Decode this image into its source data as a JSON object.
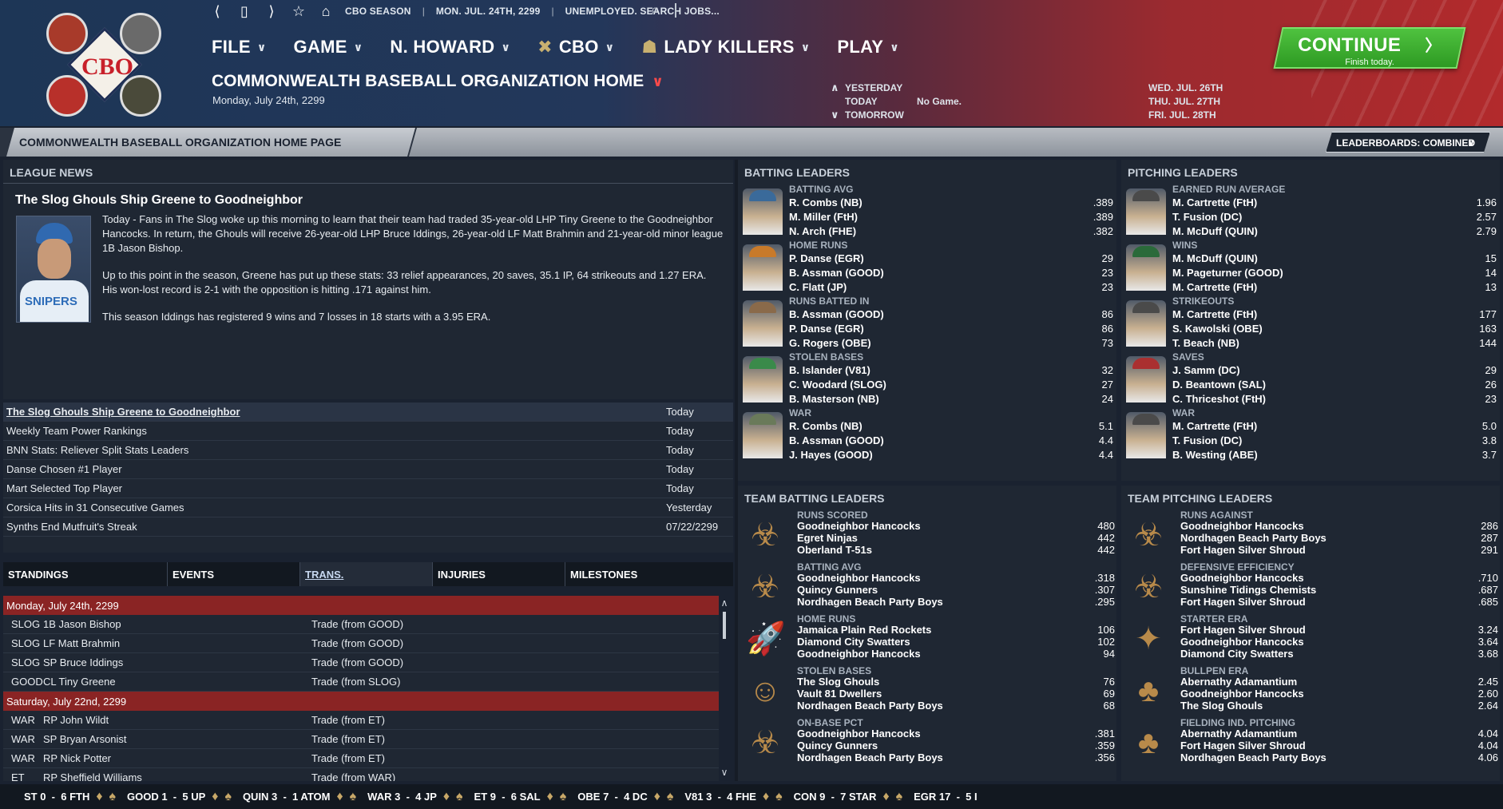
{
  "header": {
    "status": {
      "season": "CBO SEASON",
      "date": "MON. JUL. 24TH, 2299",
      "job": "UNEMPLOYED. SEARCH JOBS..."
    },
    "logo_text": "CBO",
    "menu": [
      {
        "label": "FILE"
      },
      {
        "label": "GAME"
      },
      {
        "label": "N. HOWARD"
      },
      {
        "label": "CBO"
      },
      {
        "label": "LADY KILLERS"
      },
      {
        "label": "PLAY"
      }
    ],
    "page_title": "COMMONWEALTH BASEBALL ORGANIZATION HOME",
    "page_date": "Monday, July 24th, 2299",
    "schedule": [
      {
        "arrow": "∧",
        "label": "YESTERDAY",
        "game": "",
        "next": "WED. JUL. 26TH"
      },
      {
        "arrow": "",
        "label": "TODAY",
        "game": "No Game.",
        "next": "THU. JUL. 27TH"
      },
      {
        "arrow": "∨",
        "label": "TOMORROW",
        "game": "",
        "next": "FRI. JUL. 28TH"
      }
    ],
    "continue": {
      "label": "CONTINUE",
      "sub": "Finish today."
    }
  },
  "title_strip": {
    "tab": "COMMONWEALTH BASEBALL ORGANIZATION HOME PAGE",
    "leaderboards": "LEADERBOARDS: COMBINED"
  },
  "news": {
    "heading": "LEAGUE NEWS",
    "headline": "The Slog Ghouls Ship Greene to Goodneighbor",
    "jersey_text": "SNIPERS",
    "p1": "Today - Fans in The Slog woke up this morning to learn that their team had traded 35-year-old LHP Tiny Greene to the Goodneighbor Hancocks. In return, the Ghouls will receive 26-year-old LHP Bruce Iddings, 26-year-old LF Matt Brahmin and 21-year-old minor league 1B Jason Bishop.",
    "p2": "Up to this point in the season, Greene has put up these stats: 33 relief appearances, 20 saves, 35.1 IP, 64 strikeouts and 1.27 ERA. His won-lost record is 2-1 with the opposition is hitting .171 against him.",
    "p3": "This season Iddings has registered 9 wins and 7 losses in 18 starts with a 3.95 ERA.",
    "items": [
      {
        "title": "The Slog Ghouls Ship Greene to Goodneighbor",
        "date": "Today"
      },
      {
        "title": "Weekly Team Power Rankings",
        "date": "Today"
      },
      {
        "title": "BNN Stats: Reliever Split Stats Leaders",
        "date": "Today"
      },
      {
        "title": "Danse Chosen #1 Player",
        "date": "Today"
      },
      {
        "title": "Mart Selected Top Player",
        "date": "Today"
      },
      {
        "title": "Corsica Hits in 31 Consecutive Games",
        "date": "Yesterday"
      },
      {
        "title": "Synths End Mutfruit's Streak",
        "date": "07/22/2299"
      }
    ]
  },
  "tabs": [
    "STANDINGS",
    "EVENTS",
    "TRANS.",
    "INJURIES",
    "MILESTONES"
  ],
  "transactions": [
    {
      "date": "Monday, July 24th, 2299",
      "rows": [
        {
          "team": "SLOG",
          "player": "1B Jason Bishop",
          "type": "Trade (from GOOD)"
        },
        {
          "team": "SLOG",
          "player": "LF Matt Brahmin",
          "type": "Trade (from GOOD)"
        },
        {
          "team": "SLOG",
          "player": "SP Bruce Iddings",
          "type": "Trade (from GOOD)"
        },
        {
          "team": "GOOD",
          "player": "CL Tiny Greene",
          "type": "Trade (from SLOG)"
        }
      ]
    },
    {
      "date": "Saturday, July 22nd, 2299",
      "rows": [
        {
          "team": "WAR",
          "player": "RP John Wildt",
          "type": "Trade (from ET)"
        },
        {
          "team": "WAR",
          "player": "SP Bryan Arsonist",
          "type": "Trade (from ET)"
        },
        {
          "team": "WAR",
          "player": "RP Nick Potter",
          "type": "Trade (from ET)"
        },
        {
          "team": "ET",
          "player": "RP Sheffield Williams",
          "type": "Trade (from WAR)"
        }
      ]
    }
  ],
  "batting_leaders": {
    "heading": "BATTING LEADERS",
    "groups": [
      {
        "stat": "BATTING AVG",
        "cap": "#3a6a9a",
        "rows": [
          [
            "R. Combs (NB)",
            ".389"
          ],
          [
            "M. Miller (FtH)",
            ".389"
          ],
          [
            "N. Arch (FHE)",
            ".382"
          ]
        ]
      },
      {
        "stat": "HOME RUNS",
        "cap": "#c87a2a",
        "rows": [
          [
            "P. Danse (EGR)",
            "29"
          ],
          [
            "B. Assman (GOOD)",
            "23"
          ],
          [
            "C. Flatt (JP)",
            "23"
          ]
        ]
      },
      {
        "stat": "RUNS BATTED IN",
        "cap": "#8a6a4a",
        "rows": [
          [
            "B. Assman (GOOD)",
            "86"
          ],
          [
            "P. Danse (EGR)",
            "86"
          ],
          [
            "G. Rogers (OBE)",
            "73"
          ]
        ]
      },
      {
        "stat": "STOLEN BASES",
        "cap": "#3a8a4a",
        "rows": [
          [
            "B. Islander (V81)",
            "32"
          ],
          [
            "C. Woodard (SLOG)",
            "27"
          ],
          [
            "B. Masterson (NB)",
            "24"
          ]
        ]
      },
      {
        "stat": "WAR",
        "cap": "#6a7a5a",
        "rows": [
          [
            "R. Combs (NB)",
            "5.1"
          ],
          [
            "B. Assman (GOOD)",
            "4.4"
          ],
          [
            "J. Hayes (GOOD)",
            "4.4"
          ]
        ]
      }
    ]
  },
  "pitching_leaders": {
    "heading": "PITCHING LEADERS",
    "groups": [
      {
        "stat": "EARNED RUN AVERAGE",
        "cap": "#4a4a4a",
        "rows": [
          [
            "M. Cartrette (FtH)",
            "1.96"
          ],
          [
            "T. Fusion (DC)",
            "2.57"
          ],
          [
            "M. McDuff (QUIN)",
            "2.79"
          ]
        ]
      },
      {
        "stat": "WINS",
        "cap": "#2a6a3a",
        "rows": [
          [
            "M. McDuff (QUIN)",
            "15"
          ],
          [
            "M. Pageturner (GOOD)",
            "14"
          ],
          [
            "M. Cartrette (FtH)",
            "13"
          ]
        ]
      },
      {
        "stat": "STRIKEOUTS",
        "cap": "#4a4a4a",
        "rows": [
          [
            "M. Cartrette (FtH)",
            "177"
          ],
          [
            "S. Kawolski (OBE)",
            "163"
          ],
          [
            "T. Beach (NB)",
            "144"
          ]
        ]
      },
      {
        "stat": "SAVES",
        "cap": "#aa3030",
        "rows": [
          [
            "J. Samm (DC)",
            "29"
          ],
          [
            "D. Beantown (SAL)",
            "26"
          ],
          [
            "C. Thriceshot (FtH)",
            "23"
          ]
        ]
      },
      {
        "stat": "WAR",
        "cap": "#4a4a4a",
        "rows": [
          [
            "M. Cartrette (FtH)",
            "5.0"
          ],
          [
            "T. Fusion (DC)",
            "3.8"
          ],
          [
            "B. Westing (ABE)",
            "3.7"
          ]
        ]
      }
    ]
  },
  "team_batting": {
    "heading": "TEAM BATTING LEADERS",
    "groups": [
      {
        "stat": "RUNS SCORED",
        "icon": "ghoul-icon",
        "glyph": "☣",
        "rows": [
          [
            "Goodneighbor Hancocks",
            "480"
          ],
          [
            "Egret Ninjas",
            "442"
          ],
          [
            "Oberland T-51s",
            "442"
          ]
        ]
      },
      {
        "stat": "BATTING AVG",
        "icon": "ghoul-icon",
        "glyph": "☣",
        "rows": [
          [
            "Goodneighbor Hancocks",
            ".318"
          ],
          [
            "Quincy Gunners",
            ".307"
          ],
          [
            "Nordhagen Beach Party Boys",
            ".295"
          ]
        ]
      },
      {
        "stat": "HOME RUNS",
        "icon": "rocket-icon",
        "glyph": "🚀",
        "rows": [
          [
            "Jamaica Plain Red Rockets",
            "106"
          ],
          [
            "Diamond City Swatters",
            "102"
          ],
          [
            "Goodneighbor Hancocks",
            "94"
          ]
        ]
      },
      {
        "stat": "STOLEN BASES",
        "icon": "vault-boy-icon",
        "glyph": "☺",
        "rows": [
          [
            "The Slog Ghouls",
            "76"
          ],
          [
            "Vault 81 Dwellers",
            "69"
          ],
          [
            "Nordhagen Beach Party Boys",
            "68"
          ]
        ]
      },
      {
        "stat": "ON-BASE PCT",
        "icon": "ghoul-icon",
        "glyph": "☣",
        "rows": [
          [
            "Goodneighbor Hancocks",
            ".381"
          ],
          [
            "Quincy Gunners",
            ".359"
          ],
          [
            "Nordhagen Beach Party Boys",
            ".356"
          ]
        ]
      }
    ]
  },
  "team_pitching": {
    "heading": "TEAM PITCHING LEADERS",
    "groups": [
      {
        "stat": "RUNS AGAINST",
        "icon": "ghoul-icon",
        "glyph": "☣",
        "rows": [
          [
            "Goodneighbor Hancocks",
            "286"
          ],
          [
            "Nordhagen Beach Party Boys",
            "287"
          ],
          [
            "Fort Hagen Silver Shroud",
            "291"
          ]
        ]
      },
      {
        "stat": "DEFENSIVE EFFICIENCY",
        "icon": "ghoul-icon",
        "glyph": "☣",
        "rows": [
          [
            "Goodneighbor Hancocks",
            ".710"
          ],
          [
            "Sunshine Tidings Chemists",
            ".687"
          ],
          [
            "Fort Hagen Silver Shroud",
            ".685"
          ]
        ]
      },
      {
        "stat": "STARTER ERA",
        "icon": "silver-shroud-icon",
        "glyph": "✦",
        "rows": [
          [
            "Fort Hagen Silver Shroud",
            "3.24"
          ],
          [
            "Goodneighbor Hancocks",
            "3.64"
          ],
          [
            "Diamond City Swatters",
            "3.68"
          ]
        ]
      },
      {
        "stat": "BULLPEN ERA",
        "icon": "adamantium-icon",
        "glyph": "♣",
        "rows": [
          [
            "Abernathy Adamantium",
            "2.45"
          ],
          [
            "Goodneighbor Hancocks",
            "2.60"
          ],
          [
            "The Slog Ghouls",
            "2.64"
          ]
        ]
      },
      {
        "stat": "FIELDING IND. PITCHING",
        "icon": "adamantium-icon",
        "glyph": "♣",
        "rows": [
          [
            "Abernathy Adamantium",
            "4.04"
          ],
          [
            "Fort Hagen Silver Shroud",
            "4.04"
          ],
          [
            "Nordhagen Beach Party Boys",
            "4.06"
          ]
        ]
      }
    ]
  },
  "ticker": [
    "ST 0  -  6 FTH",
    "GOOD 1  -  5 UP",
    "QUIN 3  -  1 ATOM",
    "WAR 3  -  4 JP",
    "ET 9  -  6 SAL",
    "OBE 7  -  4 DC",
    "V81 3  -  4 FHE",
    "CON 9  -  7 STAR",
    "EGR 17  -  5 I"
  ]
}
